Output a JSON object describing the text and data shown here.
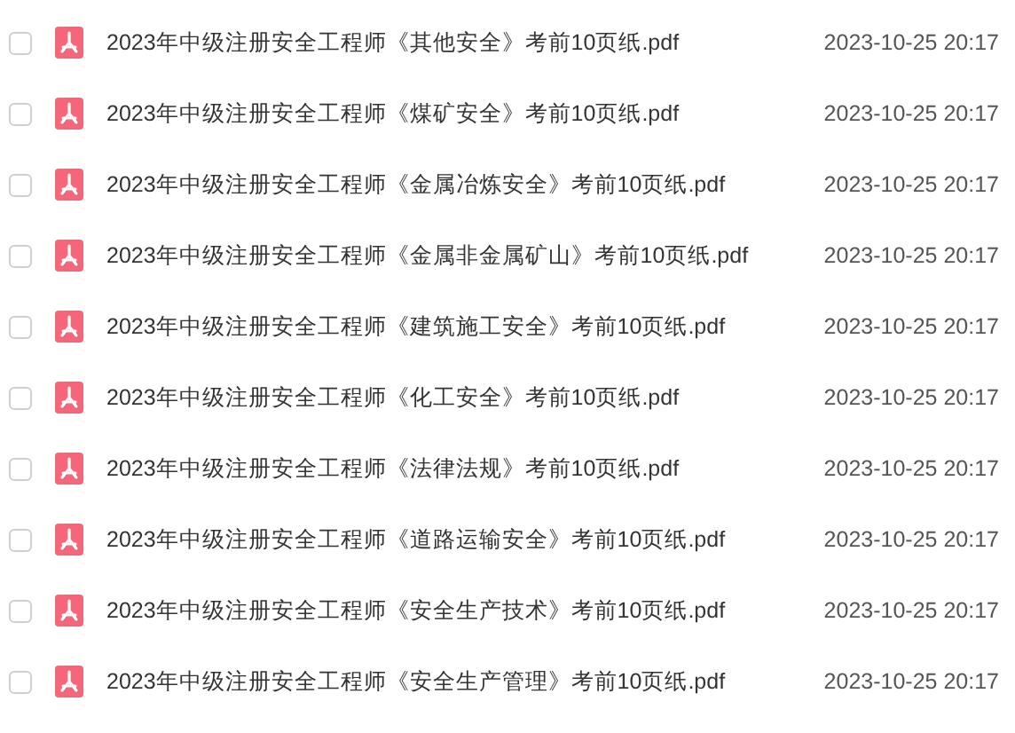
{
  "files": [
    {
      "name": "2023年中级注册安全工程师《其他安全》考前10页纸.pdf",
      "date": "2023-10-25 20:17",
      "checked": false
    },
    {
      "name": "2023年中级注册安全工程师《煤矿安全》考前10页纸.pdf",
      "date": "2023-10-25 20:17",
      "checked": false
    },
    {
      "name": "2023年中级注册安全工程师《金属冶炼安全》考前10页纸.pdf",
      "date": "2023-10-25 20:17",
      "checked": false
    },
    {
      "name": "2023年中级注册安全工程师《金属非金属矿山》考前10页纸.pdf",
      "date": "2023-10-25 20:17",
      "checked": false
    },
    {
      "name": "2023年中级注册安全工程师《建筑施工安全》考前10页纸.pdf",
      "date": "2023-10-25 20:17",
      "checked": false
    },
    {
      "name": "2023年中级注册安全工程师《化工安全》考前10页纸.pdf",
      "date": "2023-10-25 20:17",
      "checked": false
    },
    {
      "name": "2023年中级注册安全工程师《法律法规》考前10页纸.pdf",
      "date": "2023-10-25 20:17",
      "checked": false
    },
    {
      "name": "2023年中级注册安全工程师《道路运输安全》考前10页纸.pdf",
      "date": "2023-10-25 20:17",
      "checked": false
    },
    {
      "name": "2023年中级注册安全工程师《安全生产技术》考前10页纸.pdf",
      "date": "2023-10-25 20:17",
      "checked": false
    },
    {
      "name": "2023年中级注册安全工程师《安全生产管理》考前10页纸.pdf",
      "date": "2023-10-25 20:17",
      "checked": false
    }
  ]
}
